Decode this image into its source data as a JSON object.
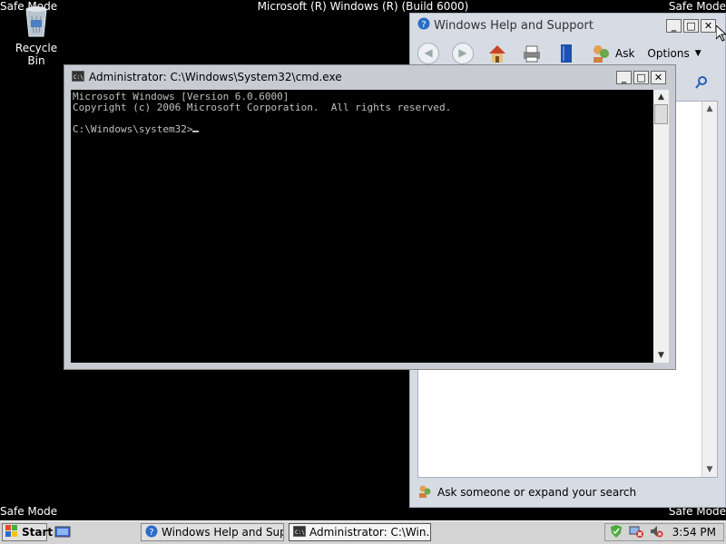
{
  "desktop": {
    "top_banner": "Microsoft (R) Windows (R) (Build 6000)",
    "safe_mode_label": "Safe Mode",
    "recycle_bin_label": "Recycle Bin"
  },
  "help_window": {
    "title": "Windows Help and Support",
    "toolbar": {
      "ask_label": "Ask",
      "options_label": "Options"
    },
    "status_text": "Ask someone or expand your search"
  },
  "cmd_window": {
    "title": "Administrator: C:\\Windows\\System32\\cmd.exe",
    "console_lines": [
      "Microsoft Windows [Version 6.0.6000]",
      "Copyright (c) 2006 Microsoft Corporation.  All rights reserved.",
      "",
      "C:\\Windows\\system32>"
    ]
  },
  "taskbar": {
    "start_label": "Start",
    "tasks": [
      {
        "label": "Windows Help and Sup...",
        "icon": "help-icon"
      },
      {
        "label": "Administrator: C:\\Win...",
        "icon": "cmd-icon"
      }
    ],
    "clock": "3:54 PM"
  },
  "colors": {
    "desktop": "#000000",
    "console_bg": "#000000",
    "console_text": "#c0c0c0"
  }
}
